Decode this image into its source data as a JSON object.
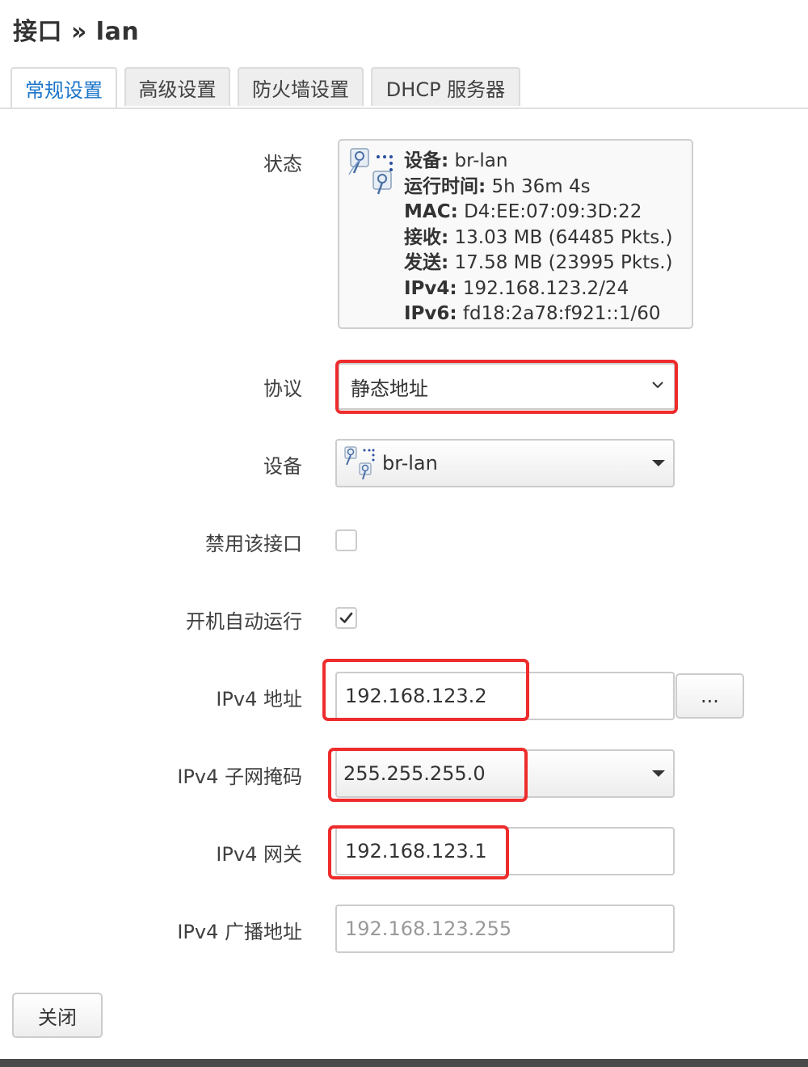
{
  "breadcrumb": {
    "section": "接口",
    "separator": "»",
    "item": "lan"
  },
  "tabs": [
    {
      "label": "常规设置",
      "active": true
    },
    {
      "label": "高级设置",
      "active": false
    },
    {
      "label": "防火墙设置",
      "active": false
    },
    {
      "label": "DHCP 服务器",
      "active": false
    }
  ],
  "form": {
    "status": {
      "label": "状态",
      "icon": "network-bridge-icon",
      "lines": [
        {
          "key": "设备:",
          "value": "br-lan"
        },
        {
          "key": "运行时间:",
          "value": "5h 36m 4s"
        },
        {
          "key": "MAC:",
          "value": "D4:EE:07:09:3D:22"
        },
        {
          "key": "接收:",
          "value": "13.03 MB (64485 Pkts.)"
        },
        {
          "key": "发送:",
          "value": "17.58 MB (23995 Pkts.)"
        },
        {
          "key": "IPv4:",
          "value": "192.168.123.2/24"
        },
        {
          "key": "IPv6:",
          "value": "fd18:2a78:f921::1/60"
        }
      ]
    },
    "protocol": {
      "label": "协议",
      "value": "静态地址"
    },
    "device": {
      "label": "设备",
      "value": "br-lan",
      "icon": "network-bridge-icon"
    },
    "disable_interface": {
      "label": "禁用该接口",
      "checked": false
    },
    "auto_start": {
      "label": "开机自动运行",
      "checked": true
    },
    "ipv4_address": {
      "label": "IPv4 地址",
      "value": "192.168.123.2",
      "more_button": "..."
    },
    "ipv4_netmask": {
      "label": "IPv4 子网掩码",
      "value": "255.255.255.0"
    },
    "ipv4_gateway": {
      "label": "IPv4 网关",
      "value": "192.168.123.1"
    },
    "ipv4_broadcast": {
      "label": "IPv4 广播地址",
      "placeholder": "192.168.123.255"
    }
  },
  "footer": {
    "close_label": "关闭"
  },
  "colors": {
    "accent": "#1a74c9",
    "highlight": "#ee2c2c"
  }
}
